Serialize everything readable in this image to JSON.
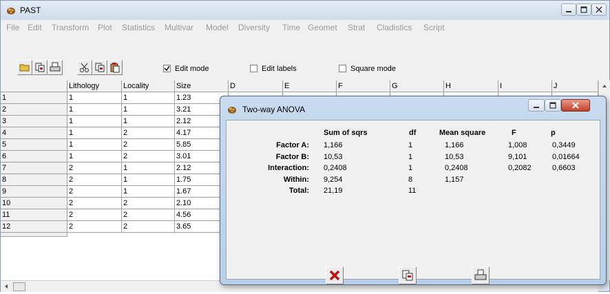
{
  "window": {
    "title": "PAST"
  },
  "menu": [
    "File",
    "Edit",
    "Transform",
    "Plot",
    "Statistics",
    "Multivar",
    "Model",
    "Diversity",
    "Time",
    "Geomet",
    "Strat",
    "Cladistics",
    "Script"
  ],
  "toolbar": {
    "edit_mode_label": "Edit mode",
    "edit_mode_checked": true,
    "edit_labels_label": "Edit labels",
    "edit_labels_checked": false,
    "square_mode_label": "Square mode",
    "square_mode_checked": false
  },
  "grid": {
    "columns": [
      "Lithology",
      "Locality",
      "Size",
      "D",
      "E",
      "F",
      "G",
      "H",
      "I",
      "J"
    ],
    "rows": [
      {
        "label": "1",
        "cells": [
          "1",
          "1",
          "1.23"
        ]
      },
      {
        "label": "2",
        "cells": [
          "1",
          "1",
          "3.21"
        ]
      },
      {
        "label": "3",
        "cells": [
          "1",
          "1",
          "2.12"
        ]
      },
      {
        "label": "4",
        "cells": [
          "1",
          "2",
          "4.17"
        ]
      },
      {
        "label": "5",
        "cells": [
          "1",
          "2",
          "5.85"
        ]
      },
      {
        "label": "6",
        "cells": [
          "1",
          "2",
          "3.01"
        ]
      },
      {
        "label": "7",
        "cells": [
          "2",
          "1",
          "2.12"
        ]
      },
      {
        "label": "8",
        "cells": [
          "2",
          "1",
          "1.75"
        ]
      },
      {
        "label": "9",
        "cells": [
          "2",
          "1",
          "1.67"
        ]
      },
      {
        "label": "10",
        "cells": [
          "2",
          "2",
          "2.10"
        ]
      },
      {
        "label": "11",
        "cells": [
          "2",
          "2",
          "4.56"
        ]
      },
      {
        "label": "12",
        "cells": [
          "2",
          "2",
          "3.65"
        ]
      }
    ]
  },
  "dialog": {
    "title": "Two-way ANOVA",
    "headers": [
      "Sum of sqrs",
      "df",
      "Mean square",
      "F",
      "p"
    ],
    "rows": [
      {
        "label": "Factor A:",
        "ss": "1,166",
        "df": "1",
        "ms": "1,166",
        "f": "1,008",
        "p": "0,3449"
      },
      {
        "label": "Factor B:",
        "ss": "10,53",
        "df": "1",
        "ms": "10,53",
        "f": "9,101",
        "p": "0,01664"
      },
      {
        "label": "Interaction:",
        "ss": "0,2408",
        "df": "1",
        "ms": "0,2408",
        "f": "0,2082",
        "p": "0,6603"
      },
      {
        "label": "Within:",
        "ss": "9,254",
        "df": "8",
        "ms": "1,157",
        "f": "",
        "p": ""
      },
      {
        "label": "Total:",
        "ss": "21,19",
        "df": "11",
        "ms": "",
        "f": "",
        "p": ""
      }
    ]
  }
}
